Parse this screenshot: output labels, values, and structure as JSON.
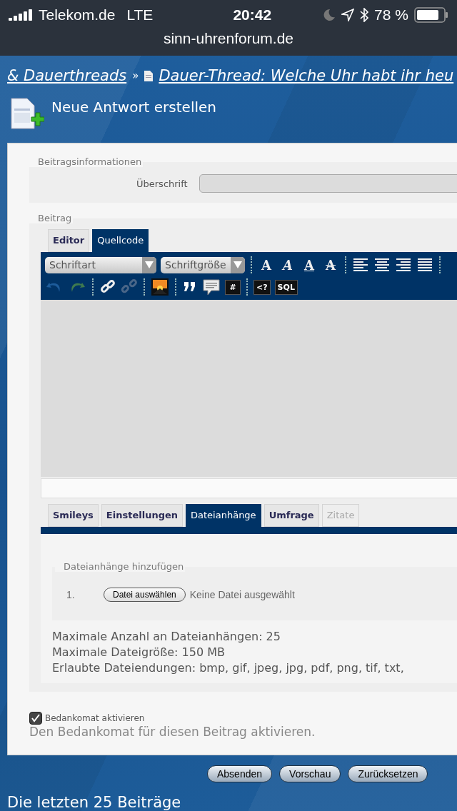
{
  "status_bar": {
    "carrier": "Telekom.de",
    "network": "LTE",
    "time": "20:42",
    "battery": "78 %"
  },
  "address_bar": {
    "url": "sinn-uhrenforum.de"
  },
  "breadcrumb": [
    {
      "kind": "link",
      "label": "& Dauerthreads"
    },
    {
      "kind": "separator",
      "label": "»"
    },
    {
      "kind": "page",
      "label": "Dauer-Thread: Welche Uhr habt ihr heu"
    }
  ],
  "page_title": "Neue Antwort erstellen",
  "post_info": {
    "legend": "Beitragsinformationen",
    "subject_label": "Überschrift"
  },
  "post": {
    "legend": "Beitrag",
    "editor_tabs": [
      {
        "label": "Editor",
        "selected": false
      },
      {
        "label": "Quellcode",
        "selected": true
      }
    ],
    "font_select": "Schriftart",
    "size_select": "Schriftgröße",
    "toolbar_rows": [
      [
        {
          "kind": "bold",
          "label": "A"
        },
        {
          "kind": "italic",
          "label": "A"
        },
        {
          "kind": "underline",
          "label": "A"
        },
        {
          "kind": "strike",
          "label": "A"
        },
        {
          "kind": "separator"
        },
        {
          "kind": "align-left"
        },
        {
          "kind": "align-center"
        },
        {
          "kind": "align-right"
        },
        {
          "kind": "justify"
        },
        {
          "kind": "separator"
        }
      ],
      [
        {
          "kind": "undo"
        },
        {
          "kind": "redo"
        },
        {
          "kind": "separator"
        },
        {
          "kind": "link"
        },
        {
          "kind": "unlink"
        },
        {
          "kind": "separator"
        },
        {
          "kind": "image"
        },
        {
          "kind": "separator"
        },
        {
          "kind": "quote"
        },
        {
          "kind": "comment"
        },
        {
          "kind": "code",
          "label": "#"
        },
        {
          "kind": "separator"
        },
        {
          "kind": "code",
          "label": "<?"
        },
        {
          "kind": "code",
          "label": "SQL"
        }
      ]
    ],
    "option_tabs": [
      {
        "label": "Smileys",
        "selected": false,
        "disabled": false
      },
      {
        "label": "Einstellungen",
        "selected": false,
        "disabled": false
      },
      {
        "label": "Dateianhänge",
        "selected": true,
        "disabled": false
      },
      {
        "label": "Umfrage",
        "selected": false,
        "disabled": false
      },
      {
        "label": "Zitate",
        "selected": false,
        "disabled": true
      }
    ],
    "attachments": {
      "legend": "Dateianhänge hinzufügen",
      "rows": [
        {
          "number": "1.",
          "button": "Datei auswählen",
          "status": "Keine Datei ausgewählt"
        }
      ],
      "info": [
        "Maximale Anzahl an Dateianhängen: 25",
        "Maximale Dateigröße: 150 MB",
        "Erlaubte Dateiendungen: bmp, gif, jpeg, jpg, pdf, png, tif, txt,"
      ]
    }
  },
  "bedankomat": {
    "label": "Bedankomat aktivieren",
    "checked": true,
    "description": "Den Bedankomat für diesen Beitrag aktivieren."
  },
  "buttons": [
    "Absenden",
    "Vorschau",
    "Zurücksetzen"
  ],
  "section_title": "Die letzten 25 Beiträge"
}
